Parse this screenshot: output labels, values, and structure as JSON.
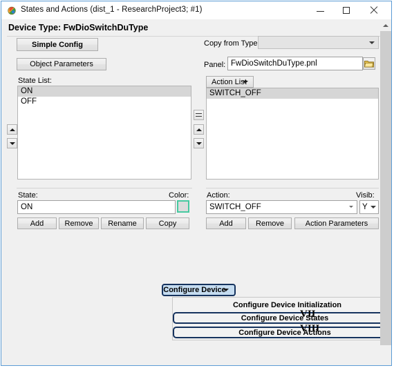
{
  "window": {
    "title": "States and Actions (dist_1 - ResearchProject3; #1)",
    "icon": "globe-icon",
    "minimize_label": "–",
    "maximize_label": "□",
    "close_label": "✕"
  },
  "header": {
    "device_type": "Device Type: FwDioSwitchDuType"
  },
  "left": {
    "simple_config_label": "Simple Config",
    "object_parameters_label": "Object Parameters",
    "state_list_label": "State List:",
    "state_list_items": [
      {
        "label": "ON",
        "selected": true
      },
      {
        "label": "OFF",
        "selected": false
      }
    ],
    "state_field_label": "State:",
    "state_field_value": "ON",
    "color_label": "Color:",
    "color_swatch_fill": "#dcdcdc",
    "color_swatch_border": "#46c9a0",
    "buttons": [
      "Add",
      "Remove",
      "Rename",
      "Copy"
    ]
  },
  "right": {
    "copy_from_type_label": "Copy from Type:",
    "copy_from_type_value": "",
    "panel_label": "Panel:",
    "panel_value": "FwDioSwitchDuType.pnl",
    "browse_icon": "folder-icon",
    "action_list_label": "Action List",
    "action_list_items": [
      {
        "label": "SWITCH_OFF",
        "selected": true
      }
    ],
    "action_field_label": "Action:",
    "action_field_value": "SWITCH_OFF",
    "visib_label": "Visib:",
    "visib_value": "Y",
    "buttons": [
      "Add",
      "Remove",
      "Action Parameters"
    ]
  },
  "configure_menu": {
    "button_label": "Configure Device",
    "button_bg": "#c5dcf0",
    "button_border": "#16335e",
    "items": [
      {
        "label": "Configure Device Initialization",
        "highlighted": false,
        "marker": ""
      },
      {
        "label": "Configure Device States",
        "highlighted": true,
        "marker": "VII"
      },
      {
        "label": "Configure Device Actions",
        "highlighted": true,
        "marker": "VIII"
      }
    ]
  },
  "markers": {
    "seven": "VII",
    "eight": "VIII"
  },
  "spinners": {
    "left_up": "up-arrow-icon",
    "left_down": "down-arrow-icon",
    "mid_bar": "bar-icon",
    "mid_up": "up-arrow-icon",
    "mid_down": "down-arrow-icon"
  }
}
